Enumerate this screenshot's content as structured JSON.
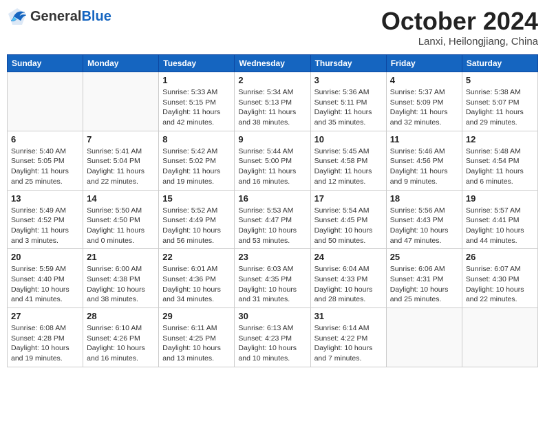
{
  "header": {
    "logo_general": "General",
    "logo_blue": "Blue",
    "month": "October 2024",
    "location": "Lanxi, Heilongjiang, China"
  },
  "weekdays": [
    "Sunday",
    "Monday",
    "Tuesday",
    "Wednesday",
    "Thursday",
    "Friday",
    "Saturday"
  ],
  "weeks": [
    [
      {
        "day": "",
        "info": ""
      },
      {
        "day": "",
        "info": ""
      },
      {
        "day": "1",
        "info": "Sunrise: 5:33 AM\nSunset: 5:15 PM\nDaylight: 11 hours and 42 minutes."
      },
      {
        "day": "2",
        "info": "Sunrise: 5:34 AM\nSunset: 5:13 PM\nDaylight: 11 hours and 38 minutes."
      },
      {
        "day": "3",
        "info": "Sunrise: 5:36 AM\nSunset: 5:11 PM\nDaylight: 11 hours and 35 minutes."
      },
      {
        "day": "4",
        "info": "Sunrise: 5:37 AM\nSunset: 5:09 PM\nDaylight: 11 hours and 32 minutes."
      },
      {
        "day": "5",
        "info": "Sunrise: 5:38 AM\nSunset: 5:07 PM\nDaylight: 11 hours and 29 minutes."
      }
    ],
    [
      {
        "day": "6",
        "info": "Sunrise: 5:40 AM\nSunset: 5:05 PM\nDaylight: 11 hours and 25 minutes."
      },
      {
        "day": "7",
        "info": "Sunrise: 5:41 AM\nSunset: 5:04 PM\nDaylight: 11 hours and 22 minutes."
      },
      {
        "day": "8",
        "info": "Sunrise: 5:42 AM\nSunset: 5:02 PM\nDaylight: 11 hours and 19 minutes."
      },
      {
        "day": "9",
        "info": "Sunrise: 5:44 AM\nSunset: 5:00 PM\nDaylight: 11 hours and 16 minutes."
      },
      {
        "day": "10",
        "info": "Sunrise: 5:45 AM\nSunset: 4:58 PM\nDaylight: 11 hours and 12 minutes."
      },
      {
        "day": "11",
        "info": "Sunrise: 5:46 AM\nSunset: 4:56 PM\nDaylight: 11 hours and 9 minutes."
      },
      {
        "day": "12",
        "info": "Sunrise: 5:48 AM\nSunset: 4:54 PM\nDaylight: 11 hours and 6 minutes."
      }
    ],
    [
      {
        "day": "13",
        "info": "Sunrise: 5:49 AM\nSunset: 4:52 PM\nDaylight: 11 hours and 3 minutes."
      },
      {
        "day": "14",
        "info": "Sunrise: 5:50 AM\nSunset: 4:50 PM\nDaylight: 11 hours and 0 minutes."
      },
      {
        "day": "15",
        "info": "Sunrise: 5:52 AM\nSunset: 4:49 PM\nDaylight: 10 hours and 56 minutes."
      },
      {
        "day": "16",
        "info": "Sunrise: 5:53 AM\nSunset: 4:47 PM\nDaylight: 10 hours and 53 minutes."
      },
      {
        "day": "17",
        "info": "Sunrise: 5:54 AM\nSunset: 4:45 PM\nDaylight: 10 hours and 50 minutes."
      },
      {
        "day": "18",
        "info": "Sunrise: 5:56 AM\nSunset: 4:43 PM\nDaylight: 10 hours and 47 minutes."
      },
      {
        "day": "19",
        "info": "Sunrise: 5:57 AM\nSunset: 4:41 PM\nDaylight: 10 hours and 44 minutes."
      }
    ],
    [
      {
        "day": "20",
        "info": "Sunrise: 5:59 AM\nSunset: 4:40 PM\nDaylight: 10 hours and 41 minutes."
      },
      {
        "day": "21",
        "info": "Sunrise: 6:00 AM\nSunset: 4:38 PM\nDaylight: 10 hours and 38 minutes."
      },
      {
        "day": "22",
        "info": "Sunrise: 6:01 AM\nSunset: 4:36 PM\nDaylight: 10 hours and 34 minutes."
      },
      {
        "day": "23",
        "info": "Sunrise: 6:03 AM\nSunset: 4:35 PM\nDaylight: 10 hours and 31 minutes."
      },
      {
        "day": "24",
        "info": "Sunrise: 6:04 AM\nSunset: 4:33 PM\nDaylight: 10 hours and 28 minutes."
      },
      {
        "day": "25",
        "info": "Sunrise: 6:06 AM\nSunset: 4:31 PM\nDaylight: 10 hours and 25 minutes."
      },
      {
        "day": "26",
        "info": "Sunrise: 6:07 AM\nSunset: 4:30 PM\nDaylight: 10 hours and 22 minutes."
      }
    ],
    [
      {
        "day": "27",
        "info": "Sunrise: 6:08 AM\nSunset: 4:28 PM\nDaylight: 10 hours and 19 minutes."
      },
      {
        "day": "28",
        "info": "Sunrise: 6:10 AM\nSunset: 4:26 PM\nDaylight: 10 hours and 16 minutes."
      },
      {
        "day": "29",
        "info": "Sunrise: 6:11 AM\nSunset: 4:25 PM\nDaylight: 10 hours and 13 minutes."
      },
      {
        "day": "30",
        "info": "Sunrise: 6:13 AM\nSunset: 4:23 PM\nDaylight: 10 hours and 10 minutes."
      },
      {
        "day": "31",
        "info": "Sunrise: 6:14 AM\nSunset: 4:22 PM\nDaylight: 10 hours and 7 minutes."
      },
      {
        "day": "",
        "info": ""
      },
      {
        "day": "",
        "info": ""
      }
    ]
  ]
}
